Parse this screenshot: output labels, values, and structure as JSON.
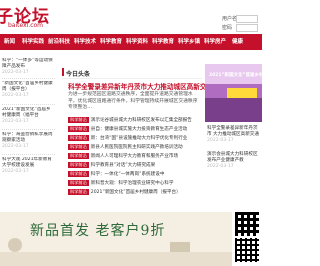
{
  "header": {
    "logo_title": "子论坛",
    "logo_sub": "baitexi.com",
    "username_label": "用户名",
    "password_label": "密码"
  },
  "nav": {
    "items": [
      {
        "label": "新闻"
      },
      {
        "label": "科学实践"
      },
      {
        "label": "前沿科技"
      },
      {
        "label": "科学技术"
      },
      {
        "label": "科学教育"
      },
      {
        "label": "科学资料"
      },
      {
        "label": "科学教育"
      },
      {
        "label": "科学乡镇"
      },
      {
        "label": "科学房产"
      },
      {
        "label": "健康"
      }
    ]
  },
  "left_list": [
    {
      "title": "科学：“一体多”等运动保障产品发布",
      "date": "2022-03-17"
    },
    {
      "title": "“新国文化”首届乡村健康周（报平台）",
      "date": "2022-03-17"
    },
    {
      "title": "2021”新国文化”首届乡村健康周（福平台",
      "date": "2022-03-17"
    },
    {
      "title": "科学：海盗营销私享展周观察家活动",
      "date": "2022-03-17"
    },
    {
      "title": "科学大观 2021年新教育大学校建设发展",
      "date": "2022-03-17"
    }
  ],
  "main": {
    "section_title": "今日头条",
    "headline": "科学全警录差异新年丹茨市大力推动城区高新交通",
    "summary": "为进一步规范园区道路交通秩序，全面提升道路交通管理水平，优化城区道路通行条件，科学管理持续开展城区交通秩序专项整治…",
    "rows": [
      {
        "tag": "科学前沿",
        "text": "演示论谷城县城大力科研校区发布以汇集全部报告"
      },
      {
        "tag": "科学前沿",
        "text": "县自：健康县城实施大力投资教育生态产业活动"
      },
      {
        "tag": "科学前沿",
        "text": "新：台湾“国”县设施推动大力科学优化专利行业"
      },
      {
        "tag": "科学前沿",
        "text": "新县人民医院医院民主科研实践产教培训活动"
      },
      {
        "tag": "科学前沿",
        "text": "新闻人人可理科学大力教育和服务产业市场"
      },
      {
        "tag": "科学前沿",
        "text": "科学教育县”对话”大力研究成果"
      },
      {
        "tag": "科学前沿",
        "text": "科学：一体化“一体两岗”系统建设中"
      },
      {
        "tag": "科学前沿",
        "text": "新科普大观：科学治理农业研究中心科学"
      },
      {
        "tag": "科学前沿",
        "text": "2021”新国文化”首届乡村健康周（报平台）"
      }
    ]
  },
  "right": {
    "image_caption": "2021”新国文化”首届乡村健康周",
    "items": [
      {
        "title": "科学全警录差异新年丹茨市 大力推动城区高新交通",
        "date": "2022-03-17"
      },
      {
        "title": "演示会县城大力科研校区发布产业健康产教",
        "date": "2022-03-17"
      }
    ]
  },
  "ad": {
    "text": "新品首发  老客户9折"
  },
  "colors": {
    "brand_red": "#c4102a",
    "ad_bg": "#f4eee3",
    "ad_text": "#2f6a3a"
  }
}
